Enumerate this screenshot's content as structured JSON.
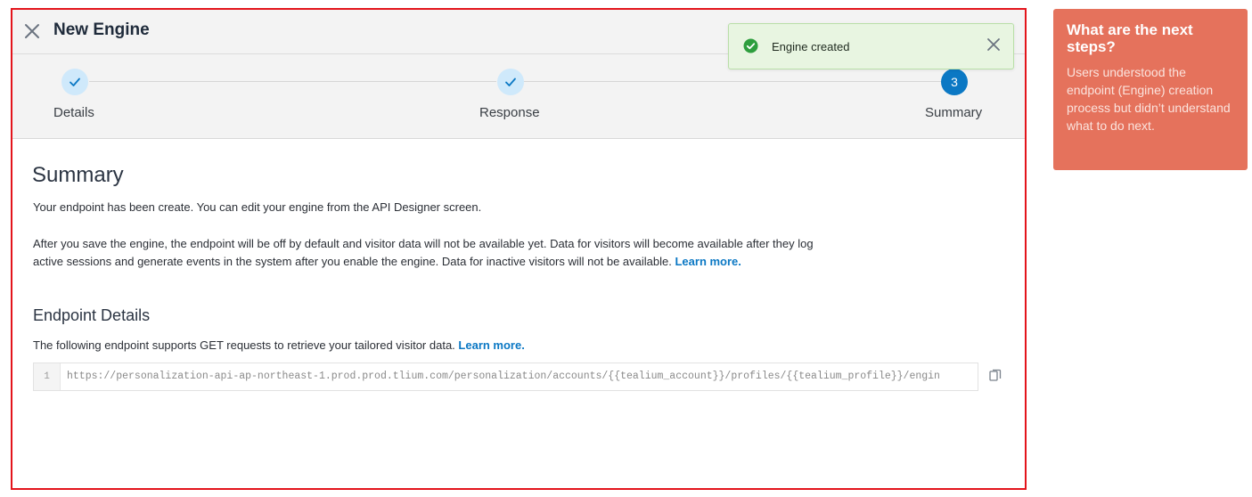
{
  "dialog": {
    "title": "New Engine",
    "toast_text": "Engine created"
  },
  "steps": [
    {
      "label": "Details",
      "state": "done"
    },
    {
      "label": "Response",
      "state": "done"
    },
    {
      "label": "Summary",
      "state": "current",
      "number": "3"
    }
  ],
  "summary": {
    "title": "Summary",
    "intro": "Your endpoint has been create. You can edit your engine from the API Designer screen.",
    "availability_text": "After you save the engine, the endpoint will be off by default and visitor data will not be available yet. Data for visitors will become available after they log active sessions and generate events in the system after you enable the engine. Data for inactive visitors will not be available.",
    "availability_link": "Learn more."
  },
  "endpoint": {
    "title": "Endpoint Details",
    "description": "The following endpoint supports GET requests to retrieve your tailored visitor data.",
    "link": "Learn more.",
    "line_number": "1",
    "url": "https://personalization-api-ap-northeast-1.prod.prod.tlium.com/personalization/accounts/{{tealium_account}}/profiles/{{tealium_profile}}/engin"
  },
  "annotation": {
    "title": "What are the next steps?",
    "body": "Users understood the endpoint (Engine) creation process but didn’t understand what to do next."
  },
  "colors": {
    "highlight_border": "#e3141b",
    "accent": "#0b78c4",
    "toast_bg": "#e8f5e1",
    "success": "#2e9e3e",
    "note_bg": "#e5725c"
  },
  "icons": {
    "close": "close-icon",
    "check": "check-icon",
    "success": "check-circle-icon",
    "copy": "copy-icon"
  }
}
